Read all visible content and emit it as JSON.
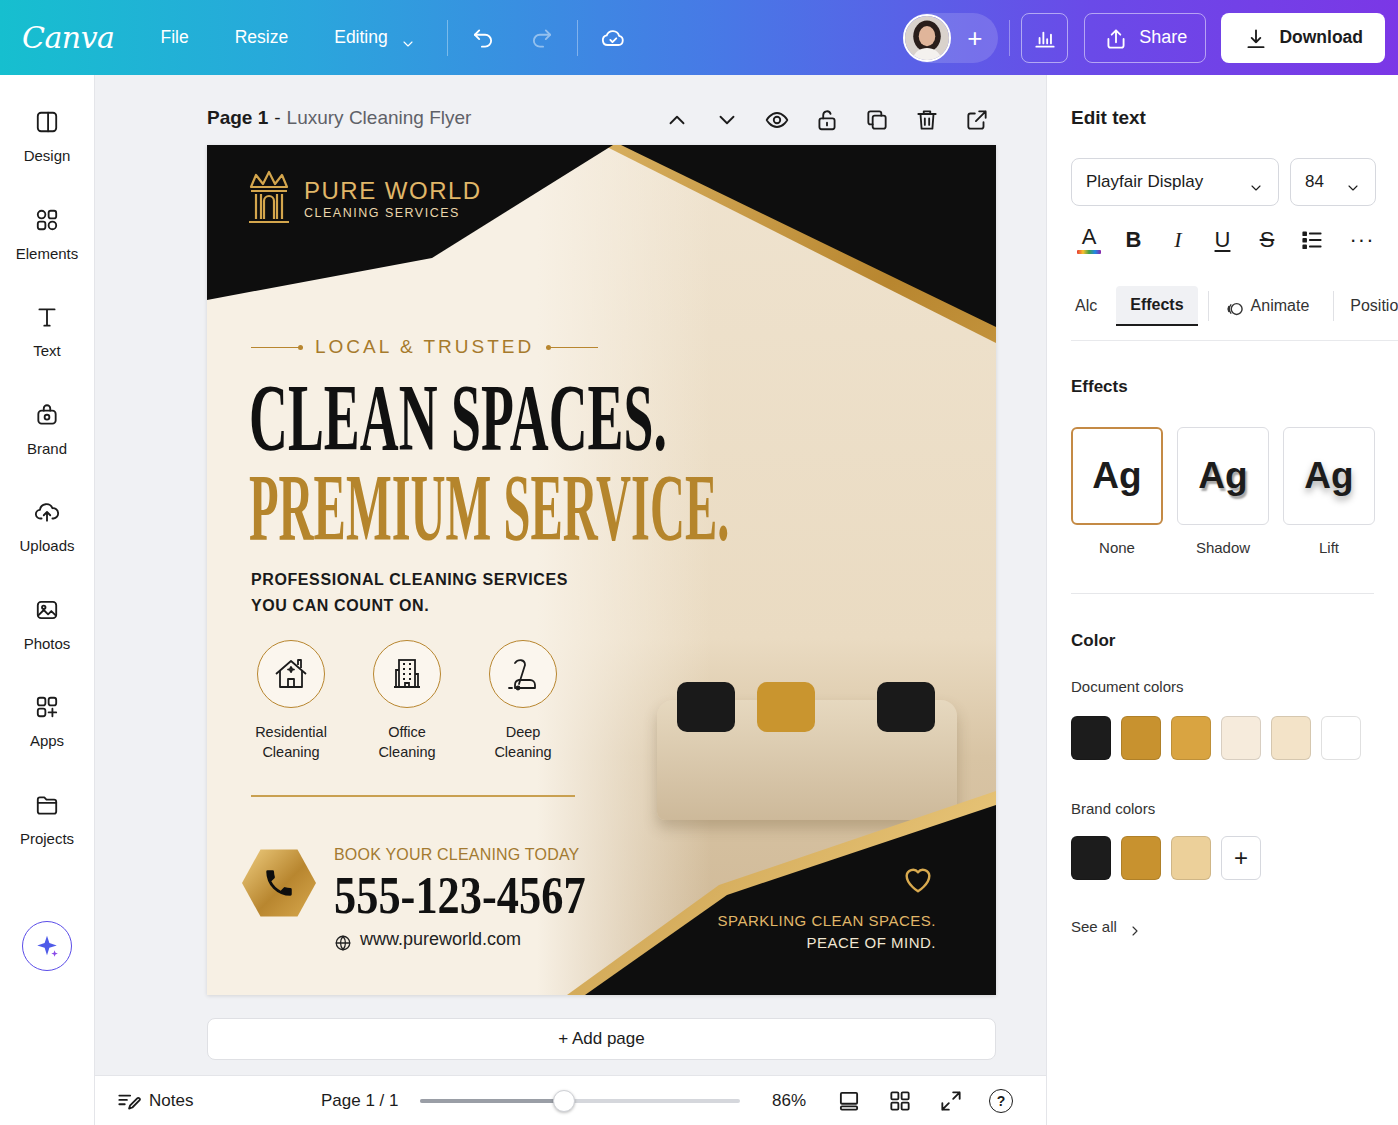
{
  "topbar": {
    "logo": "Canva",
    "menu": [
      {
        "label": "File",
        "dropdown": false
      },
      {
        "label": "Resize",
        "dropdown": false
      },
      {
        "label": "Editing",
        "dropdown": true
      }
    ],
    "undo": {
      "disabled": false
    },
    "redo": {
      "disabled": true
    },
    "add": "+",
    "share": "Share",
    "download": "Download"
  },
  "sidebar": {
    "items": [
      {
        "label": "Design"
      },
      {
        "label": "Elements"
      },
      {
        "label": "Text"
      },
      {
        "label": "Brand"
      },
      {
        "label": "Uploads"
      },
      {
        "label": "Photos"
      },
      {
        "label": "Apps"
      },
      {
        "label": "Projects"
      }
    ]
  },
  "page_header": {
    "page": "Page 1",
    "separator": "-",
    "title": "Luxury Cleaning Flyer"
  },
  "flyer": {
    "brand": {
      "name": "PURE WORLD",
      "tagline": "CLEANING SERVICES"
    },
    "eyebrow": "LOCAL & TRUSTED",
    "headline": [
      "CLEAN SPACES.",
      "PREMIUM SERVICE."
    ],
    "subhead": [
      "PROFESSIONAL CLEANING SERVICES",
      "YOU CAN COUNT ON."
    ],
    "services": [
      {
        "label": [
          "Residential",
          "Cleaning"
        ]
      },
      {
        "label": [
          "Office",
          "Cleaning"
        ]
      },
      {
        "label": [
          "Deep",
          "Cleaning"
        ]
      }
    ],
    "cta": "BOOK YOUR CLEANING TODAY",
    "phone": "555-123-4567",
    "website": "www.pureworld.com",
    "slogan": [
      "SPARKLING CLEAN SPACES.",
      "PEACE OF MIND."
    ]
  },
  "add_page": "+ Add page",
  "status_bar": {
    "notes": "Notes",
    "page": "Page 1 / 1",
    "zoom": {
      "level": 0.45,
      "reading": "86%"
    },
    "help": "?"
  },
  "panel": {
    "title": "Edit text",
    "font": "Playfair Display",
    "size": "84",
    "format": [
      {
        "label": "A",
        "kind": "color"
      },
      {
        "label": "B",
        "kind": "bold"
      },
      {
        "label": "I",
        "kind": "italic"
      },
      {
        "label": "U",
        "kind": "underline"
      },
      {
        "label": "S",
        "kind": "strike"
      }
    ],
    "more": "···",
    "tabs": [
      {
        "label": "Alc",
        "selected": false
      },
      {
        "label": "Effects",
        "selected": true
      },
      {
        "label": "Animate",
        "selected": false
      },
      {
        "label": "Positio",
        "selected": false
      }
    ],
    "effects": {
      "title": "Effects",
      "options": [
        {
          "label": "None",
          "sample": "Ag",
          "kind": "none",
          "selected": true
        },
        {
          "label": "Shadow",
          "sample": "Ag",
          "kind": "shadow",
          "selected": false
        },
        {
          "label": "Lift",
          "sample": "Ag",
          "kind": "lift",
          "selected": false
        }
      ]
    },
    "color": {
      "title": "Color",
      "document": {
        "label": "Document colors",
        "swatches": [
          {
            "color": "#1c1c1c"
          },
          {
            "color": "#c8922f"
          },
          {
            "color": "#d9a441"
          },
          {
            "color": "#f6ebdc"
          },
          {
            "color": "#f3e3c8"
          },
          {
            "color": "#ffffff"
          }
        ]
      },
      "brand": {
        "label": "Brand colors",
        "swatches": [
          {
            "color": "#1c1c1c"
          },
          {
            "color": "#c8922f"
          },
          {
            "color": "#ecd09a"
          }
        ],
        "add": "+"
      },
      "see_all": "See all"
    }
  }
}
